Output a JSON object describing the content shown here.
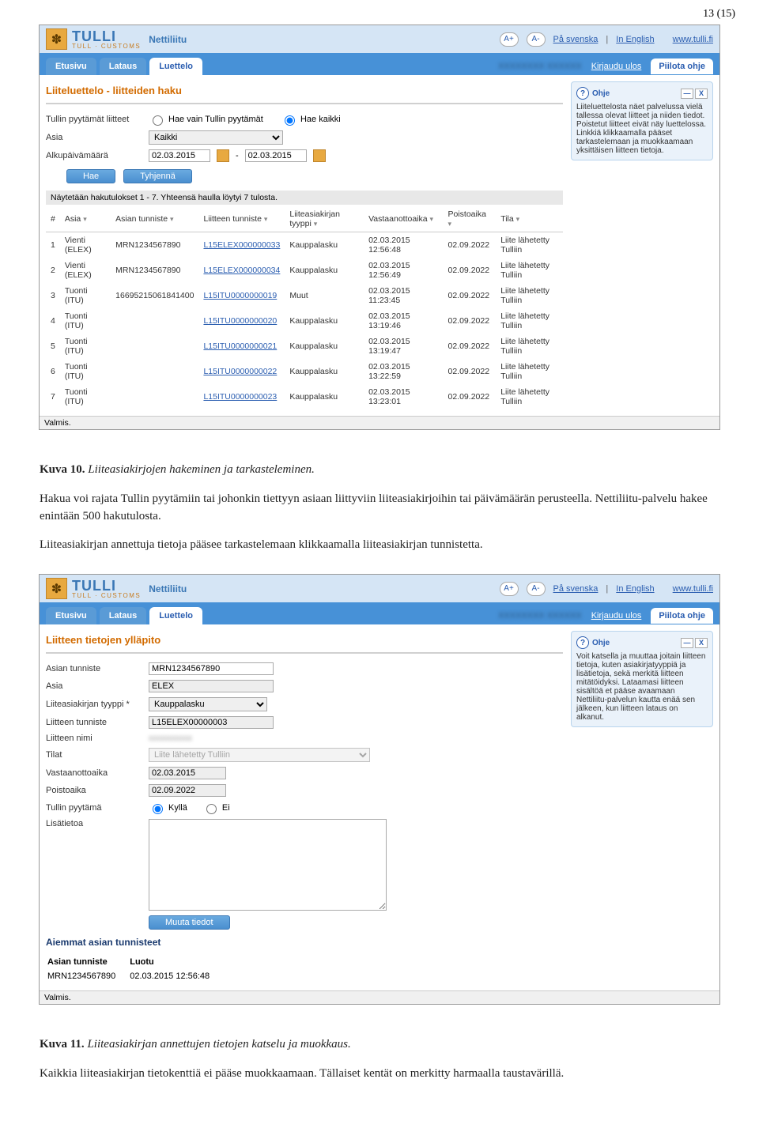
{
  "page_number": "13 (15)",
  "header": {
    "logo_text": "TULLI",
    "logo_sub": "TULL · CUSTOMS",
    "app_name": "Nettiliitu",
    "font_plus": "A+",
    "font_minus": "A-",
    "lang_sv": "På svenska",
    "lang_en": "In English",
    "site_url": "www.tulli.fi",
    "blurred_user": "XXXXXXXX XXXXXX",
    "logout": "Kirjaudu ulos",
    "hide_help": "Piilota ohje"
  },
  "tabs": {
    "t0": "Etusivu",
    "t1": "Lataus",
    "t2": "Luettelo"
  },
  "screenshot1": {
    "title": "Liiteluettelo - liitteiden haku",
    "labels": {
      "tullin_pyytamat": "Tullin pyytämät liitteet",
      "asia": "Asia",
      "alkupaiva": "Alkupäivämäärä"
    },
    "radios": {
      "hae_vain": "Hae vain Tullin pyytämät",
      "hae_kaikki": "Hae kaikki"
    },
    "asia_select": "Kaikki",
    "date_from": "02.03.2015",
    "date_to": "02.03.2015",
    "btn_hae": "Hae",
    "btn_tyhjenna": "Tyhjennä",
    "results_info": "Näytetään hakutulokset 1 - 7. Yhteensä haulla löytyi 7 tulosta.",
    "cols": {
      "num": "#",
      "asia": "Asia",
      "asian_tunniste": "Asian tunniste",
      "liitteen_tunniste": "Liitteen tunniste",
      "tyyppi": "Liiteasiakirjan tyyppi",
      "vastaanotto": "Vastaanottoaika",
      "poistoaika": "Poistoaika",
      "tila": "Tila"
    },
    "rows": [
      {
        "n": "1",
        "asia": "Vienti (ELEX)",
        "at": "MRN1234567890",
        "lt": "L15ELEX000000033",
        "ty": "Kauppalasku",
        "va": "02.03.2015 12:56:48",
        "pa": "02.09.2022",
        "ti": "Liite lähetetty Tulliin"
      },
      {
        "n": "2",
        "asia": "Vienti (ELEX)",
        "at": "MRN1234567890",
        "lt": "L15ELEX000000034",
        "ty": "Kauppalasku",
        "va": "02.03.2015 12:56:49",
        "pa": "02.09.2022",
        "ti": "Liite lähetetty Tulliin"
      },
      {
        "n": "3",
        "asia": "Tuonti (ITU)",
        "at": "16695215061841400",
        "lt": "L15ITU0000000019",
        "ty": "Muut",
        "va": "02.03.2015 11:23:45",
        "pa": "02.09.2022",
        "ti": "Liite lähetetty Tulliin"
      },
      {
        "n": "4",
        "asia": "Tuonti (ITU)",
        "at": "",
        "lt": "L15ITU0000000020",
        "ty": "Kauppalasku",
        "va": "02.03.2015 13:19:46",
        "pa": "02.09.2022",
        "ti": "Liite lähetetty Tulliin"
      },
      {
        "n": "5",
        "asia": "Tuonti (ITU)",
        "at": "",
        "lt": "L15ITU0000000021",
        "ty": "Kauppalasku",
        "va": "02.03.2015 13:19:47",
        "pa": "02.09.2022",
        "ti": "Liite lähetetty Tulliin"
      },
      {
        "n": "6",
        "asia": "Tuonti (ITU)",
        "at": "",
        "lt": "L15ITU0000000022",
        "ty": "Kauppalasku",
        "va": "02.03.2015 13:22:59",
        "pa": "02.09.2022",
        "ti": "Liite lähetetty Tulliin"
      },
      {
        "n": "7",
        "asia": "Tuonti (ITU)",
        "at": "",
        "lt": "L15ITU0000000023",
        "ty": "Kauppalasku",
        "va": "02.03.2015 13:23:01",
        "pa": "02.09.2022",
        "ti": "Liite lähetetty Tulliin"
      }
    ],
    "help": {
      "title": "Ohje",
      "text": "Liiteluettelosta näet palvelussa vielä tallessa olevat liitteet ja niiden tiedot. Poistetut liitteet eivät näy luettelossa. Linkkiä klikkaamalla pääset tarkastelemaan ja muokkaamaan yksittäisen liitteen tietoja."
    },
    "status": "Valmis."
  },
  "caption1_label": "Kuva 10.",
  "caption1_text": " Liiteasiakirjojen hakeminen ja tarkasteleminen.",
  "para1": "Hakua voi rajata Tullin pyytämiin tai johonkin tiettyyn asiaan liittyviin liiteasiakirjoihin tai päivämäärän perusteella. Nettiliitu-palvelu hakee enintään 500 hakutulosta.",
  "para2": "Liiteasiakirjan annettuja tietoja pääsee tarkastelemaan klikkaamalla liiteasiakirjan tunnistetta.",
  "screenshot2": {
    "title": "Liitteen tietojen ylläpito",
    "labels": {
      "asian_tunniste": "Asian tunniste",
      "asia": "Asia",
      "tyyppi": "Liiteasiakirjan tyyppi *",
      "liitteen_tunniste": "Liitteen tunniste",
      "liitteen_nimi": "Liitteen nimi",
      "tilat": "Tilat",
      "vastaanottoaika": "Vastaanottoaika",
      "poistoaika": "Poistoaika",
      "tullin_pyytama": "Tullin pyytämä",
      "lisatietoa": "Lisätietoa"
    },
    "values": {
      "asian_tunniste": "MRN1234567890",
      "asia": "ELEX",
      "tyyppi": "Kauppalasku",
      "liitteen_tunniste": "L15ELEX00000003",
      "liitteen_nimi": "",
      "tilat": "Liite lähetetty Tulliin",
      "vastaanottoaika": "02.03.2015",
      "poistoaika": "02.09.2022"
    },
    "radios": {
      "kylla": "Kyllä",
      "ei": "Ei"
    },
    "btn_muuta": "Muuta tiedot",
    "aiemmat_header": "Aiemmat asian tunnisteet",
    "aiemmat_cols": {
      "tunniste": "Asian tunniste",
      "luotu": "Luotu"
    },
    "aiemmat_row": {
      "tunniste": "MRN1234567890",
      "luotu": "02.03.2015 12:56:48"
    },
    "help": {
      "title": "Ohje",
      "text": "Voit katsella ja muuttaa joitain liitteen tietoja, kuten asiakirjatyyppiä ja lisätietoja, sekä merkitä liitteen mitätöidyksi. Lataamasi liitteen sisältöä et pääse avaamaan Nettiliitu-palvelun kautta enää sen jälkeen, kun liitteen lataus on alkanut."
    },
    "status": "Valmis."
  },
  "caption2_label": "Kuva 11.",
  "caption2_text": " Liiteasiakirjan annettujen tietojen katselu ja muokkaus.",
  "para3": "Kaikkia liiteasiakirjan tietokenttiä ei pääse muokkaamaan. Tällaiset kentät on merkitty harmaalla taustavärillä."
}
